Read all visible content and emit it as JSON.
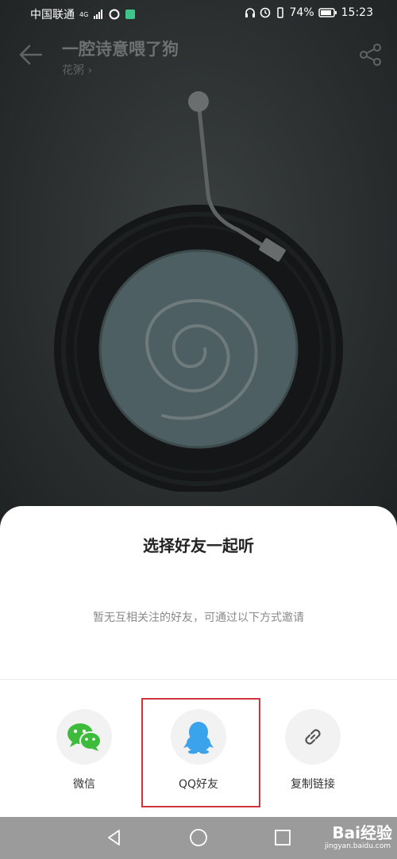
{
  "status_bar": {
    "carrier": "中国联通",
    "network": "4G",
    "battery": "74%",
    "time": "15:23"
  },
  "header": {
    "song_title": "一腔诗意喂了狗",
    "artist": "花粥 ›"
  },
  "sheet": {
    "title": "选择好友一起听",
    "empty_text": "暂无互相关注的好友，可通过以下方式邀请",
    "options": [
      {
        "label": "微信",
        "icon": "wechat-icon",
        "color": "#3dbb3b"
      },
      {
        "label": "QQ好友",
        "icon": "qq-icon",
        "color": "#3aa3ec"
      },
      {
        "label": "复制链接",
        "icon": "link-icon",
        "color": "#555555"
      }
    ]
  },
  "watermark": {
    "brand": "Bai经验",
    "url": "jingyan.baidu.com"
  },
  "colors": {
    "highlight_border": "#d0343a",
    "nav_bar": "#9b9b9b"
  }
}
